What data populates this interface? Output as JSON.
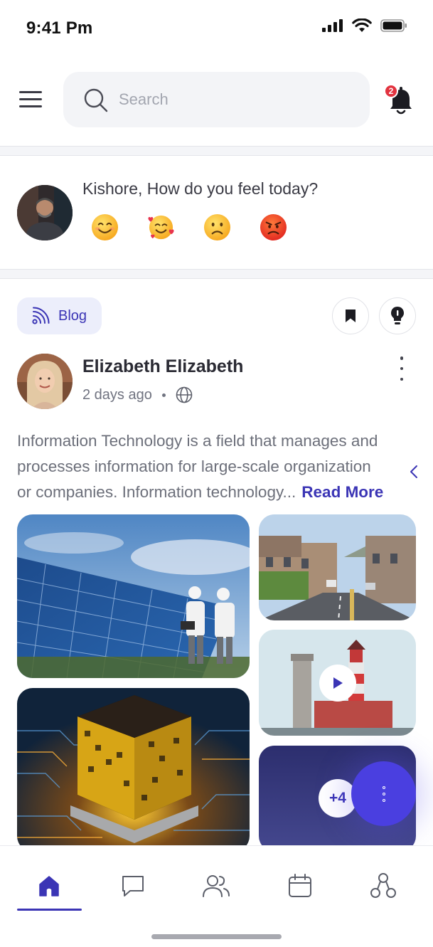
{
  "status_bar": {
    "time": "9:41 Pm"
  },
  "header": {
    "search": {
      "placeholder": "Search",
      "value": ""
    },
    "notifications": {
      "count": "2"
    }
  },
  "mood": {
    "question": "Kishore, How do you feel today?",
    "emojis": [
      "smiling-face-icon",
      "smiling-face-with-hearts-icon",
      "slightly-frowning-face-icon",
      "angry-face-icon"
    ]
  },
  "post": {
    "category": "Blog",
    "author": "Elizabeth Elizabeth",
    "time_ago": "2 days ago",
    "visibility_icon": "globe-icon",
    "body_lines": [
      "Information Technology is a field that manages and",
      "processes information for large-scale organization",
      "or companies. Information technology..."
    ],
    "read_more": "Read More",
    "more_images_count": "+4"
  },
  "colors": {
    "accent": "#3b35b5",
    "fab": "#4a3fe0",
    "badge": "#e2333f"
  },
  "bottom_nav": {
    "items": [
      "home-icon",
      "chat-icon",
      "people-icon",
      "calendar-icon",
      "org-chart-icon"
    ],
    "active": "home-icon"
  }
}
